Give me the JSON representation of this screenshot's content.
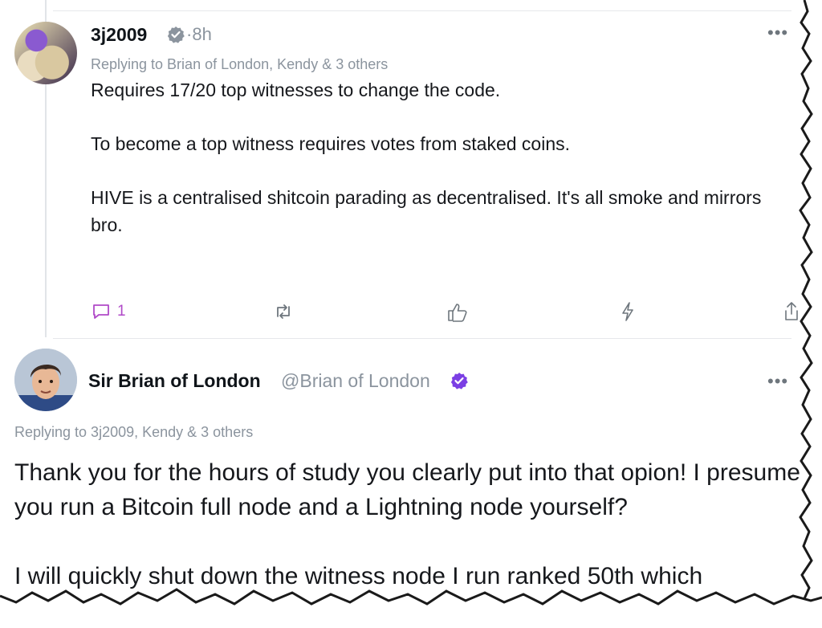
{
  "tweet1": {
    "handle": "3j2009",
    "time": "8h",
    "replying_to": "Replying to Brian of London, Kendy  & 3 others",
    "paragraphs": [
      "Requires 17/20 top witnesses to change the code.",
      "To become a top witness requires votes from staked coins.",
      "HIVE is a centralised shitcoin parading as decentralised. It's all smoke and mirrors bro."
    ],
    "reply_count": "1",
    "more": "•••"
  },
  "tweet2": {
    "name": "Sir Brian of London",
    "handle": "@Brian of London",
    "replying_to": "Replying to 3j2009, Kendy  & 3 others",
    "paragraphs": [
      "Thank you for the hours of study you clearly put into that opion! I presume you run a Bitcoin full node and a Lightning node yourself?",
      "I will quickly shut down the witness node I run ranked 50th which"
    ],
    "more": "•••"
  },
  "colors": {
    "accent_purple": "#b04ac8",
    "verified_purple": "#7b3fe4",
    "verified_grey": "#8b949e"
  }
}
